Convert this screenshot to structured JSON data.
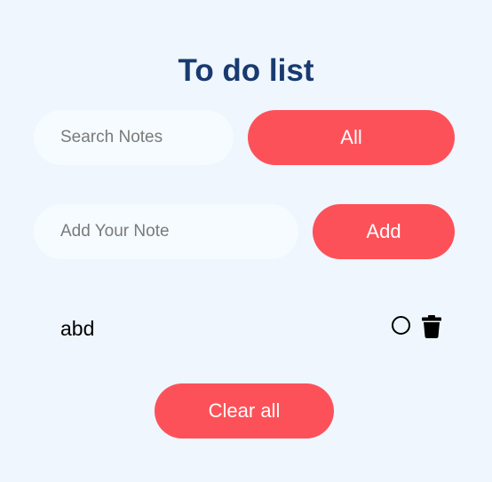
{
  "title": "To do list",
  "search": {
    "placeholder": "Search Notes",
    "value": ""
  },
  "filter": {
    "label": "All"
  },
  "add_note": {
    "placeholder": "Add Your Note",
    "value": "",
    "button_label": "Add"
  },
  "notes": [
    {
      "text": "abd",
      "done": false,
      "icons": [
        "circle-icon",
        "trash-icon"
      ]
    }
  ],
  "clear_all_label": "Clear all",
  "colors": {
    "background": "#eff6fd",
    "title": "#183a6f",
    "accent": "#fd5159",
    "input_bg": "#f5fbff"
  }
}
